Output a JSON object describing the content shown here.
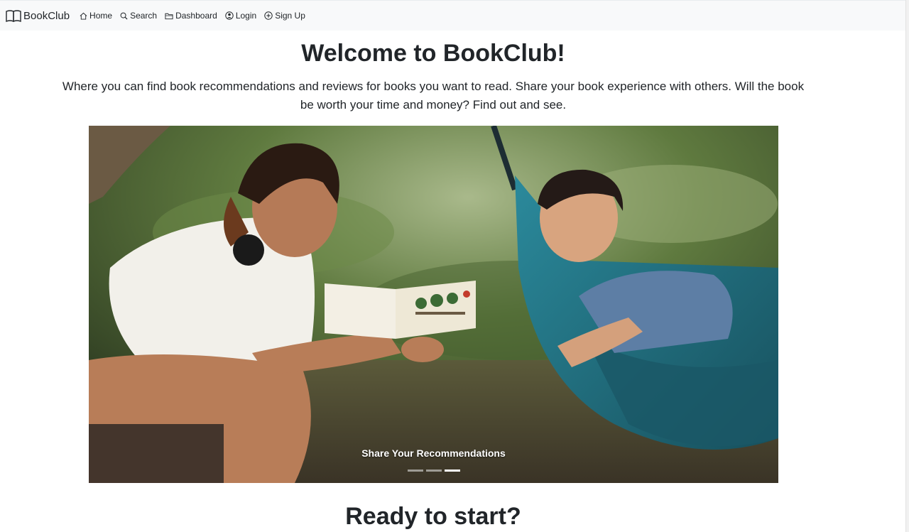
{
  "navbar": {
    "brand": "BookClub",
    "links": [
      {
        "label": "Home",
        "icon": "home-icon"
      },
      {
        "label": "Search",
        "icon": "search-icon"
      },
      {
        "label": "Dashboard",
        "icon": "folder-icon"
      },
      {
        "label": "Login",
        "icon": "user-circle-icon"
      },
      {
        "label": "Sign Up",
        "icon": "plus-circle-icon"
      }
    ]
  },
  "hero": {
    "title": "Welcome to BookClub!",
    "lead": "Where you can find book recommendations and reviews for books you want to read. Share your book experience with others. Will the book be worth your time and money? Find out and see."
  },
  "carousel": {
    "caption": "Share Your Recommendations",
    "slide_count": 3,
    "active_index": 2,
    "image_subject": "two people reading a book outdoors, one in a teal hammock"
  },
  "section": {
    "title": "Ready to start?"
  },
  "colors": {
    "navbar_bg": "#f8f9fa",
    "text": "#212529",
    "hammock": "#1e6f80"
  }
}
